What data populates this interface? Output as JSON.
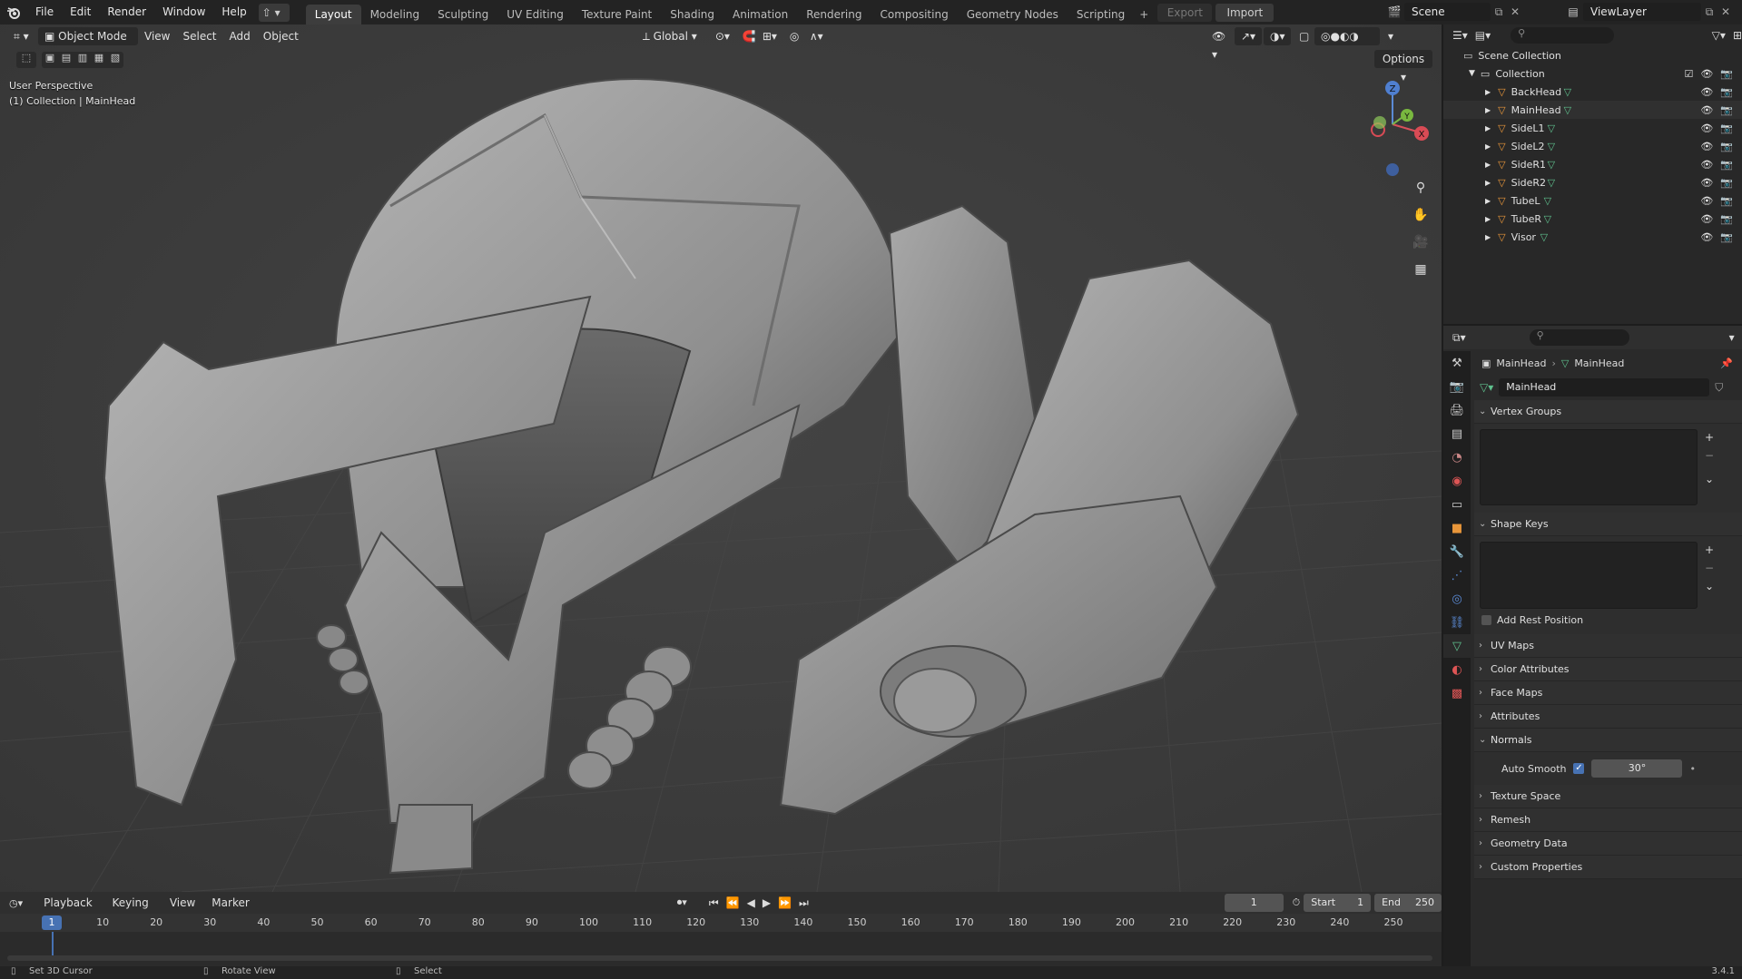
{
  "menus": [
    "File",
    "Edit",
    "Render",
    "Window",
    "Help"
  ],
  "workspaces": [
    "Layout",
    "Modeling",
    "Sculpting",
    "UV Editing",
    "Texture Paint",
    "Shading",
    "Animation",
    "Rendering",
    "Compositing",
    "Geometry Nodes",
    "Scripting"
  ],
  "top_actions": {
    "export": "Export",
    "import": "Import"
  },
  "scene": {
    "name": "Scene",
    "view_layer": "ViewLayer"
  },
  "viewport": {
    "mode": "Object Mode",
    "menus": [
      "View",
      "Select",
      "Add",
      "Object"
    ],
    "transform": "Global",
    "options": "Options",
    "perspective": "User Perspective",
    "collection_info": "(1) Collection | MainHead",
    "gizmo_axes": {
      "z": "Z",
      "y": "Y",
      "x": "X"
    }
  },
  "outliner": {
    "scene_collection": "Scene Collection",
    "collection": "Collection",
    "objects": [
      "BackHead",
      "MainHead",
      "SideL1",
      "SideL2",
      "SideR1",
      "SideR2",
      "TubeL",
      "TubeR",
      "Visor"
    ]
  },
  "properties": {
    "breadcrumb": [
      "MainHead",
      "MainHead"
    ],
    "mesh_name": "MainHead",
    "panels": {
      "vertex_groups": "Vertex Groups",
      "shape_keys": "Shape Keys",
      "add_rest_position": "Add Rest Position",
      "uv_maps": "UV Maps",
      "color_attributes": "Color Attributes",
      "face_maps": "Face Maps",
      "attributes": "Attributes",
      "normals": "Normals",
      "auto_smooth": "Auto Smooth",
      "auto_smooth_angle": "30°",
      "texture_space": "Texture Space",
      "remesh": "Remesh",
      "geometry_data": "Geometry Data",
      "custom_properties": "Custom Properties"
    }
  },
  "timeline": {
    "menus": [
      "Playback",
      "Keying",
      "View",
      "Marker"
    ],
    "current_frame": "1",
    "start_label": "Start",
    "start": "1",
    "end_label": "End",
    "end": "250",
    "ticks": [
      "10",
      "20",
      "30",
      "40",
      "50",
      "60",
      "70",
      "80",
      "90",
      "100",
      "110",
      "120",
      "130",
      "140",
      "150",
      "160",
      "170",
      "180",
      "190",
      "200",
      "210",
      "220",
      "230",
      "240",
      "250"
    ]
  },
  "status": {
    "left": "Set 3D Cursor",
    "mid": "Rotate View",
    "right": "Select",
    "version": "3.4.1"
  },
  "colors": {
    "accent": "#4772b3",
    "mesh_icon": "#e8963a",
    "data_icon": "#5fc08d"
  }
}
